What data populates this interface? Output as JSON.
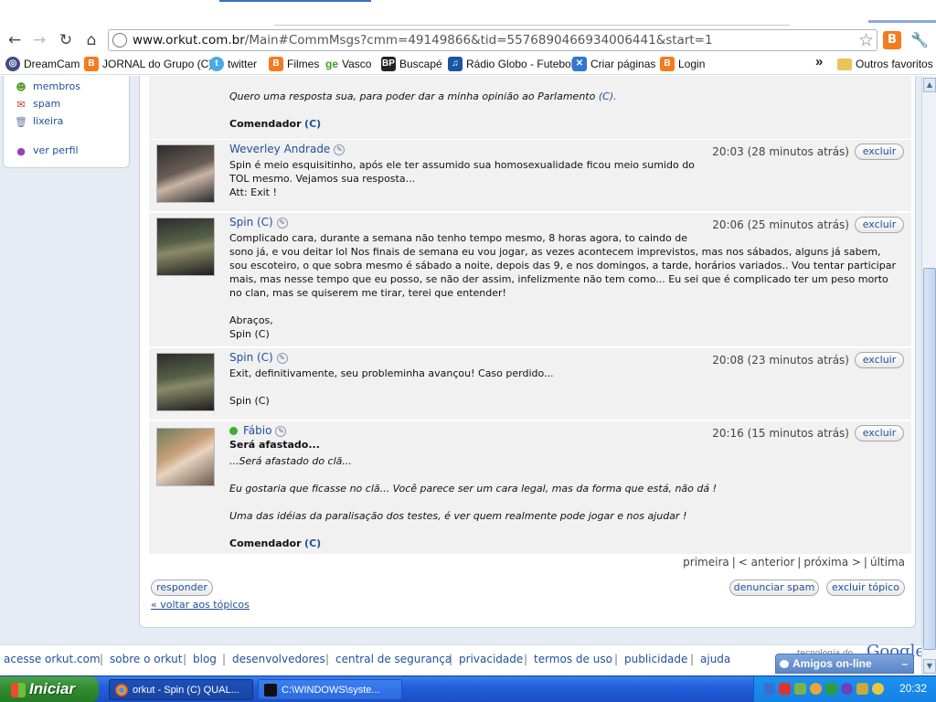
{
  "browser": {
    "url_host": "www.orkut.com.br",
    "url_path": "/Main#CommMsgs?cmm=49149866&tid=5576890466934006441&start=1",
    "bookmarks": [
      {
        "label": "DreamCam",
        "icon": "dreamcam-icon"
      },
      {
        "label": "JORNAL do Grupo (C)",
        "icon": "blogger-icon"
      },
      {
        "label": "twitter",
        "icon": "twitter-icon"
      },
      {
        "label": "Filmes",
        "icon": "blogger-icon"
      },
      {
        "label": "Vasco",
        "icon": "ge-icon"
      },
      {
        "label": "Buscapé",
        "icon": "buscape-icon"
      },
      {
        "label": "Rádio Globo - Futebol",
        "icon": "radio-icon"
      },
      {
        "label": "Criar páginas",
        "icon": "sites-icon"
      },
      {
        "label": "Login",
        "icon": "blogger-icon"
      }
    ],
    "bookmarks_more": "»",
    "other_bookmarks": "Outros favoritos"
  },
  "sidebar": {
    "items": [
      {
        "label": "membros",
        "icon": "members-icon"
      },
      {
        "label": "spam",
        "icon": "spam-icon"
      },
      {
        "label": "lixeira",
        "icon": "trash-icon"
      },
      {
        "label": "ver perfil",
        "icon": "profile-icon"
      }
    ]
  },
  "thread": {
    "prev_post": {
      "lines": [
        "Quero uma resposta sua, para poder dar a minha opinião ao Parlamento",
        "(C)."
      ],
      "signature": "Comendador",
      "signature_tag": "(C)"
    },
    "posts": [
      {
        "author": "Weverley Andrade",
        "time": "20:03 (28 minutos atrás)",
        "delete_label": "excluir",
        "lines": [
          "Spin é meio esquisitinho, após ele ter assumido sua homosexualidade ficou meio sumido do",
          "TOL mesmo. Vejamos sua resposta...",
          "Att: Exit !"
        ]
      },
      {
        "author": "Spin (C)",
        "time": "20:06 (25 minutos atrás)",
        "delete_label": "excluir",
        "lines": [
          "Complicado cara, durante a semana não tenho tempo mesmo, 8 horas agora, to caindo de",
          "sono já, e vou deitar lol Nos finais de semana eu vou jogar, as vezes acontecem imprevistos, mas nos sábados, alguns já sabem,",
          "sou escoteiro, o que sobra mesmo é sábado a noite, depois das 9, e nos domingos, a tarde, horários variados.. Vou tentar participar",
          "mais, mas nesse tempo que eu posso, se não der assim, infelizmente não tem como... Eu sei que é complicado ter um peso morto",
          "no clan, mas se quiserem me tirar, terei que entender!",
          "",
          "Abraços,",
          "Spin (C)"
        ]
      },
      {
        "author": "Spin (C)",
        "time": "20:08 (23 minutos atrás)",
        "delete_label": "excluir",
        "lines": [
          "Exit, definitivamente, seu probleminha avançou! Caso perdido...",
          "",
          "Spin (C)"
        ]
      },
      {
        "author": "Fábio",
        "time": "20:16 (15 minutos atrás)",
        "delete_label": "excluir",
        "title": "Será afastado...",
        "lines": [
          "...Será afastado do clã...",
          "",
          "Eu gostaria que ficasse no clã... Você parece ser um cara legal, mas da forma que está, não dá !",
          "",
          "Uma das idéias da paralisação dos testes, é ver quem realmente pode jogar e nos ajudar !"
        ],
        "signature": "Comendador",
        "signature_tag": "(C)"
      }
    ],
    "pager": {
      "first": "primeira",
      "prev": "< anterior",
      "next": "próxima >",
      "last": "última"
    },
    "reply_label": "responder",
    "report_spam_label": "denunciar spam",
    "delete_topic_label": "excluir tópico",
    "back_link": "« voltar aos tópicos"
  },
  "footer": {
    "links": [
      "acesse orkut.com",
      "sobre o orkut",
      "blog",
      "desenvolvedores",
      "central de segurança",
      "privacidade",
      "termos de uso",
      "publicidade",
      "ajuda"
    ],
    "powered_by": "tecnologia do",
    "google": "Google"
  },
  "amigos": {
    "label": "Amigos on-line",
    "minimize": "–"
  },
  "taskbar": {
    "start_label": "Iniciar",
    "tasks": [
      {
        "label": "orkut - Spin (C) QUAL...",
        "icon": "chrome-icon"
      },
      {
        "label": "C:\\WINDOWS\\syste...",
        "icon": "cmd-icon"
      }
    ],
    "clock": "20:32"
  }
}
